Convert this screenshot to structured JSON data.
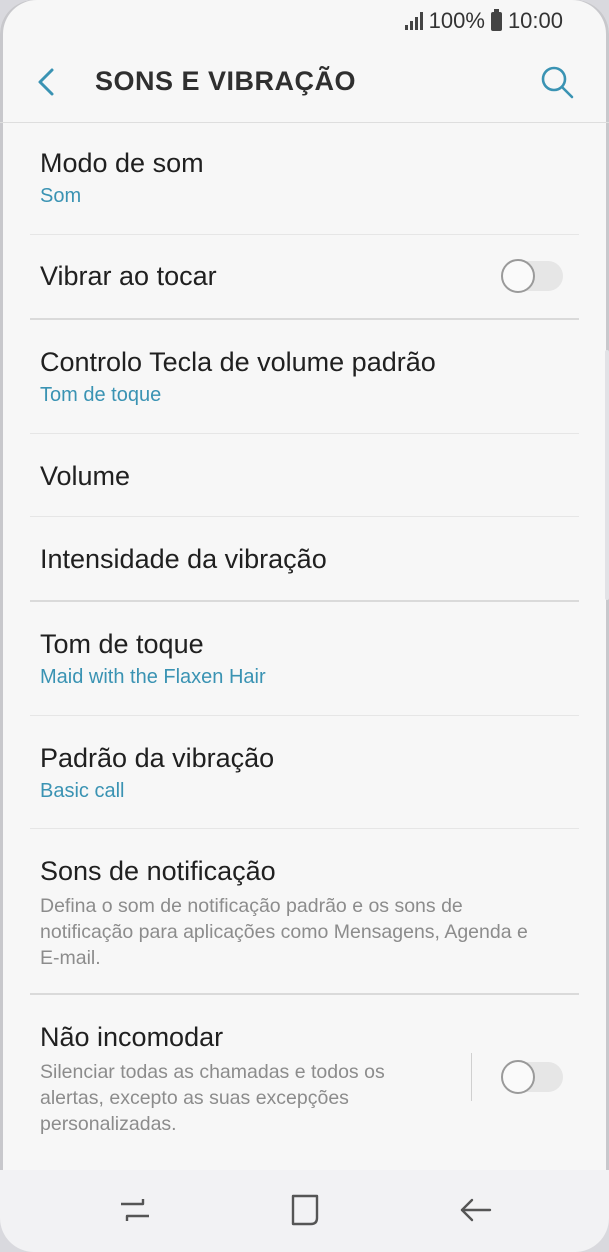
{
  "status": {
    "battery": "100%",
    "time": "10:00"
  },
  "header": {
    "title": "SONS E VIBRAÇÃO"
  },
  "items": [
    {
      "title": "Modo de som",
      "subtitle": "Som"
    },
    {
      "title": "Vibrar ao tocar",
      "toggle": false
    },
    {
      "title": "Controlo Tecla de volume padrão",
      "subtitle": "Tom de toque"
    },
    {
      "title": "Volume"
    },
    {
      "title": "Intensidade da vibração"
    },
    {
      "title": "Tom de toque",
      "subtitle": "Maid with the Flaxen Hair"
    },
    {
      "title": "Padrão da vibração",
      "subtitle": "Basic call"
    },
    {
      "title": "Sons de notificação",
      "description": "Defina o som de notificação padrão e os sons de notificação para aplicações como Mensagens, Agenda e E-mail."
    },
    {
      "title": "Não incomodar",
      "description": "Silenciar todas as chamadas e todos os alertas, excepto as suas excepções personalizadas.",
      "toggle": false
    }
  ],
  "colors": {
    "accent": "#3a93b3",
    "background": "#f7f7f7"
  },
  "icons": {
    "back": "back-arrow-icon",
    "search": "search-icon",
    "recents": "recents-icon",
    "home": "home-icon",
    "nav_back": "nav-back-icon"
  }
}
